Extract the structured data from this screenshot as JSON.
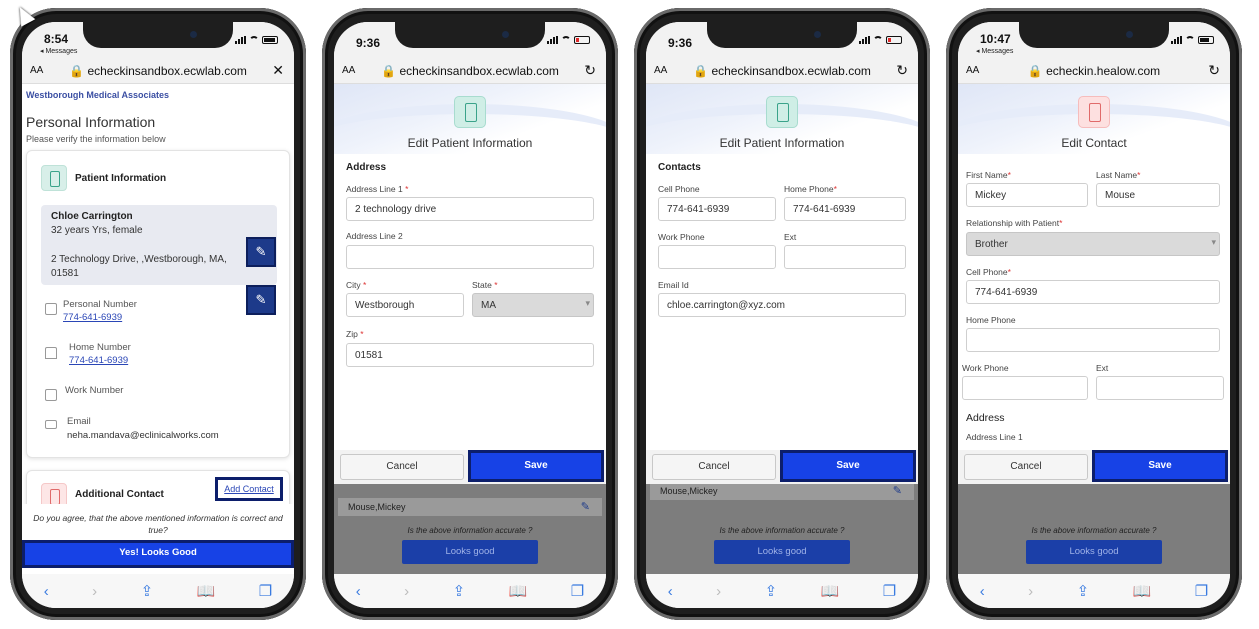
{
  "phones": [
    {
      "status_time": "8:54",
      "status_sub": "◂ Messages",
      "url_aa": "AA",
      "url": "echeckinsandbox.ecwlab.com",
      "url_action": "✕",
      "org": "Westborough Medical Associates",
      "title": "Personal Information",
      "subtitle": "Please verify the information below",
      "section": "Patient Information",
      "patient_name": "Chloe Carrington",
      "patient_age": "32 years Yrs, female",
      "patient_address": "2 Technology Drive, ,Westborough, MA, 01581",
      "personal_label": "Personal Number",
      "personal_value": "774-641-6939",
      "home_label": "Home Number",
      "home_value": "774-641-6939",
      "work_label": "Work Number",
      "email_label": "Email",
      "email_value": "neha.mandava@eclinicalworks.com",
      "additional": "Additional Contact",
      "add_contact": "Add Contact",
      "agree_text": "Do you agree, that the above mentioned information is correct and true?",
      "looks_good": "Yes! Looks Good"
    },
    {
      "status_time": "9:36",
      "url_aa": "AA",
      "url": "echeckinsandbox.ecwlab.com",
      "url_action": "↻",
      "title": "Edit Patient Information",
      "section": "Address",
      "addr1_label": "Address Line 1",
      "addr1_value": "2 technology drive",
      "addr2_label": "Address Line 2",
      "city_label": "City",
      "city_value": "Westborough",
      "state_label": "State",
      "state_value": "MA",
      "zip_label": "Zip",
      "zip_value": "01581",
      "cancel": "Cancel",
      "save": "Save",
      "row_text": "Mouse,Mickey",
      "question": "Is the above information accurate ?",
      "looks_good": "Looks good"
    },
    {
      "status_time": "9:36",
      "url_aa": "AA",
      "url": "echeckinsandbox.ecwlab.com",
      "url_action": "↻",
      "title": "Edit Patient Information",
      "section": "Contacts",
      "cell_label": "Cell Phone",
      "cell_value": "774-641-6939",
      "home_label": "Home Phone",
      "home_value": "774-641-6939",
      "work_label": "Work Phone",
      "ext_label": "Ext",
      "email_label": "Email Id",
      "email_value": "chloe.carrington@xyz.com",
      "cancel": "Cancel",
      "save": "Save",
      "row_text": "Mouse,Mickey",
      "question": "Is the above information accurate ?",
      "looks_good": "Looks good"
    },
    {
      "status_time": "10:47",
      "status_sub": "◂ Messages",
      "url_aa": "AA",
      "url": "echeckin.healow.com",
      "url_action": "↻",
      "title": "Edit Contact",
      "first_label": "First Name",
      "first_value": "Mickey",
      "last_label": "Last Name",
      "last_value": "Mouse",
      "rel_label": "Relationship with Patient",
      "rel_value": "Brother",
      "cell_label": "Cell Phone",
      "cell_value": "774-641-6939",
      "home_label": "Home Phone",
      "work_label": "Work Phone",
      "ext_label": "Ext",
      "address_section": "Address",
      "addr1_label": "Address Line 1",
      "cancel": "Cancel",
      "save": "Save",
      "question": "Is the above information accurate ?",
      "looks_good": "Looks good"
    }
  ],
  "required_mark": "*",
  "toolbar_icons": [
    "back-icon",
    "forward-icon",
    "share-icon",
    "bookmarks-icon",
    "tabs-icon"
  ],
  "colors": {
    "primary": "#1742e6",
    "primary_dark": "#0c1e6b",
    "link": "#2a46b6",
    "org": "#3b4fa3"
  }
}
